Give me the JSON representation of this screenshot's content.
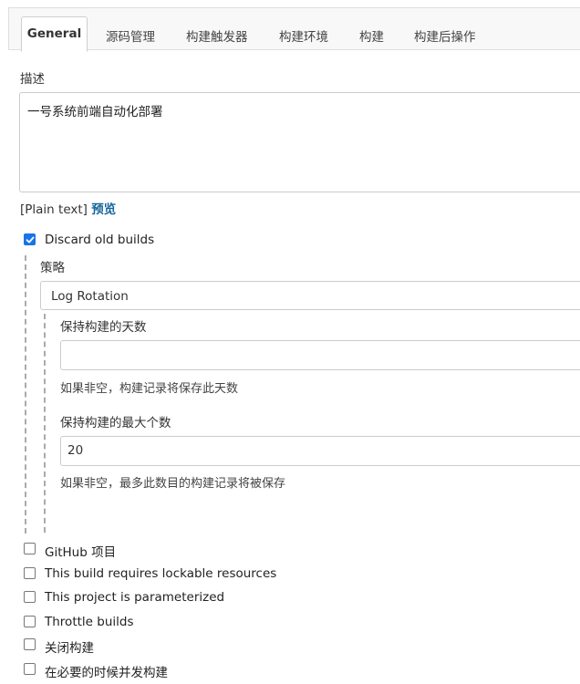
{
  "tabs": [
    "General",
    "源码管理",
    "构建触发器",
    "构建环境",
    "构建",
    "构建后操作"
  ],
  "description": {
    "label": "描述",
    "value": "一号系统前端自动化部署",
    "plain_text": "[Plain text]",
    "preview": "预览"
  },
  "discard": {
    "label": "Discard old builds",
    "checked": true,
    "strategy_label": "策略",
    "strategy_value": "Log Rotation",
    "days_label": "保持构建的天数",
    "days_value": "",
    "days_help": "如果非空，构建记录将保存此天数",
    "max_label": "保持构建的最大个数",
    "max_value": "20",
    "max_help": "如果非空，最多此数目的构建记录将被保存"
  },
  "options": [
    {
      "label": "GitHub 项目",
      "checked": false
    },
    {
      "label": "This build requires lockable resources",
      "checked": false
    },
    {
      "label": "This project is parameterized",
      "checked": false
    },
    {
      "label": "Throttle builds",
      "checked": false
    },
    {
      "label": "关闭构建",
      "checked": false
    },
    {
      "label": "在必要的时候并发构建",
      "checked": false
    }
  ],
  "colors": {
    "link": "#15659b",
    "check": "#1a73e8"
  }
}
